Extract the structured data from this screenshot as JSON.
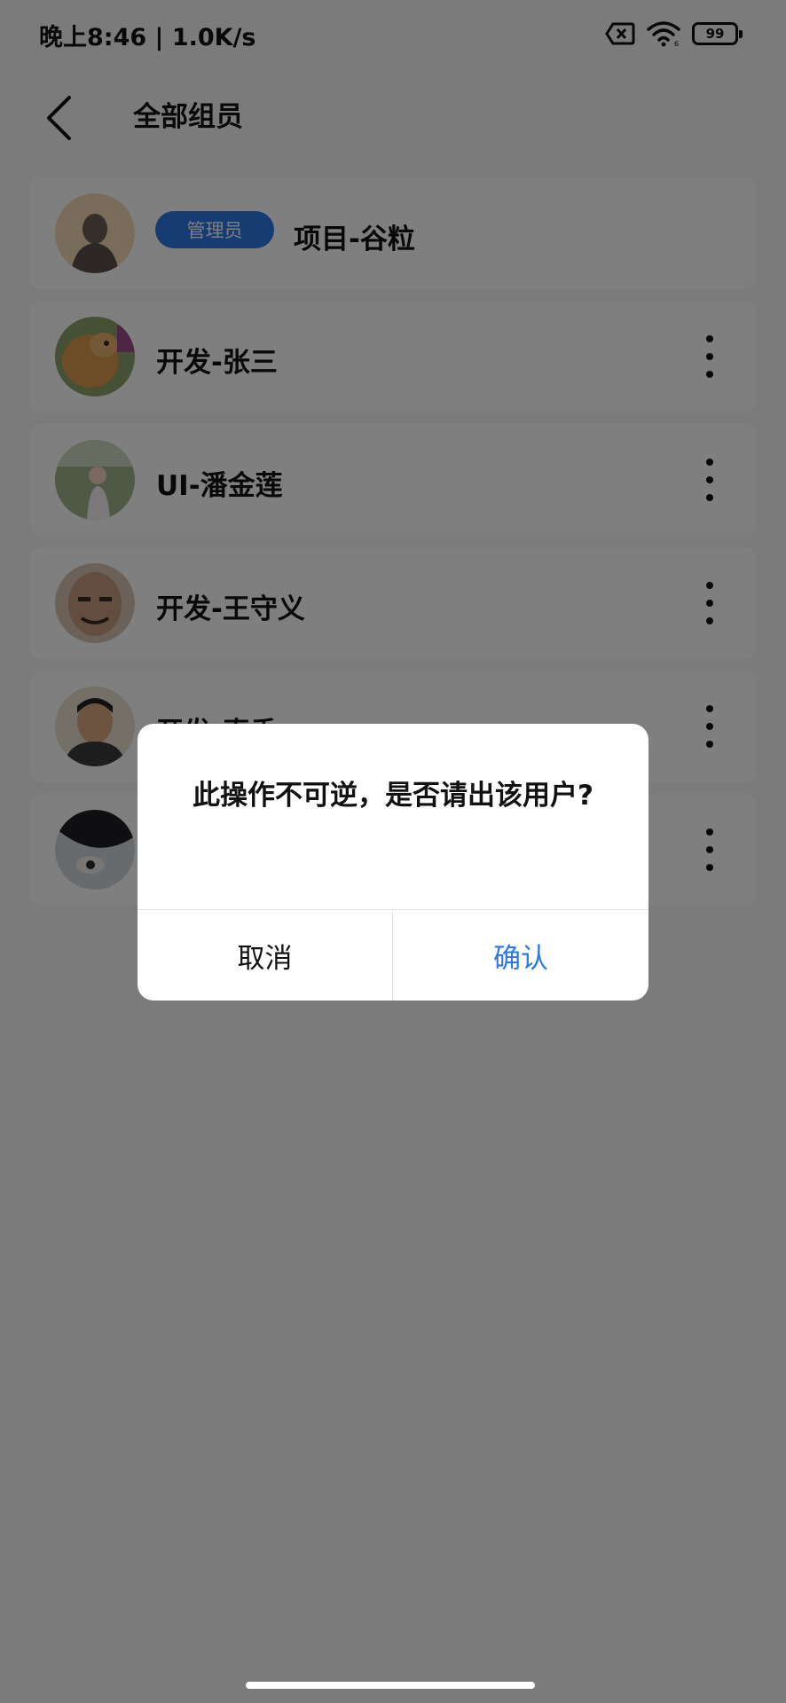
{
  "status_bar": {
    "time": "晚上8:46 | 1.0K/s",
    "battery": "99",
    "icons": [
      "sim-blocked-icon",
      "wifi-icon",
      "battery-icon"
    ]
  },
  "header": {
    "title": "全部组员",
    "back_icon": "chevron-left-icon"
  },
  "members": [
    {
      "name": "项目-谷粒",
      "badge": "管理员",
      "is_admin": true
    },
    {
      "name": "开发-张三"
    },
    {
      "name": "UI-潘金莲"
    },
    {
      "name": "开发-王守义"
    },
    {
      "name": "开发-真香"
    },
    {
      "name": ""
    }
  ],
  "dialog": {
    "message": "此操作不可逆，是否请出该用户?",
    "cancel_label": "取消",
    "confirm_label": "确认"
  },
  "colors": {
    "accent": "#2e78e6",
    "overlay": "rgba(0,0,0,0.5)",
    "background": "#f6f6f6"
  }
}
